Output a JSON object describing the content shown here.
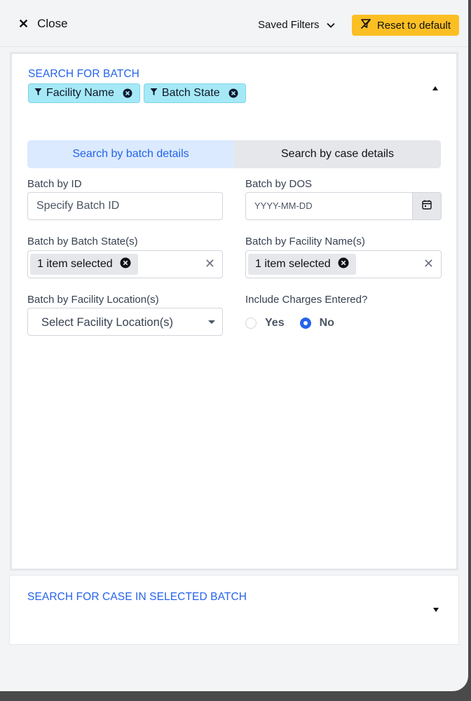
{
  "header": {
    "close_label": "Close",
    "saved_filters_label": "Saved Filters",
    "reset_label": "Reset to default"
  },
  "batch_section": {
    "title": "SEARCH FOR BATCH",
    "chips": [
      "Facility Name",
      "Batch State"
    ],
    "tabs": [
      {
        "label": "Search by batch details",
        "active": true
      },
      {
        "label": "Search by case details",
        "active": false
      }
    ],
    "batch_id": {
      "label": "Batch by ID",
      "placeholder": "Specify Batch ID",
      "value": ""
    },
    "batch_dos": {
      "label": "Batch by DOS",
      "placeholder": "YYYY-MM-DD",
      "value": ""
    },
    "batch_state": {
      "label": "Batch by Batch State(s)",
      "selected_text": "1 item selected"
    },
    "facility_name": {
      "label": "Batch by Facility Name(s)",
      "selected_text": "1 item selected"
    },
    "facility_location": {
      "label": "Batch by Facility Location(s)",
      "placeholder": "Select Facility Location(s)"
    },
    "charges": {
      "label": "Include Charges Entered?",
      "options": [
        "Yes",
        "No"
      ],
      "selected": "No"
    }
  },
  "case_section": {
    "title": "SEARCH FOR CASE IN SELECTED BATCH"
  },
  "colors": {
    "accent": "#2563eb",
    "reset_button": "#fbbf24",
    "chip_bg": "#a5e9f7",
    "active_tab_bg": "#dbeafe"
  },
  "icons": {
    "close": "close-icon",
    "saved_filters": "chevron-down-icon",
    "reset": "filter-off-icon",
    "chip": "filter-icon",
    "remove": "circle-x-icon",
    "date": "calendar-icon"
  }
}
